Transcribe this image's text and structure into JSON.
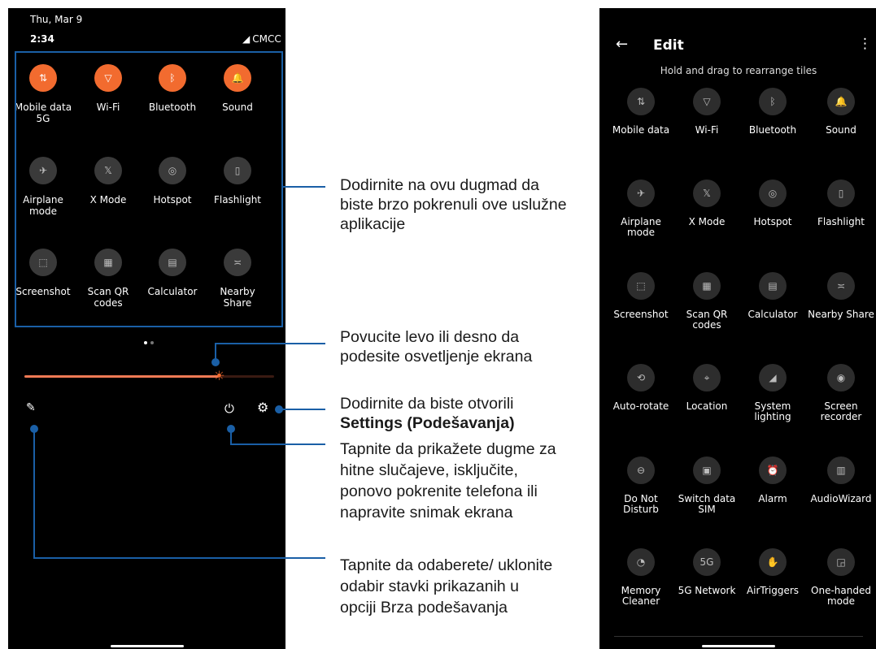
{
  "left_phone": {
    "date": "Thu, Mar 9",
    "time": "2:34",
    "carrier": "CMCC",
    "tiles": [
      {
        "icon": "mobile-data-icon",
        "glyph": "⇅",
        "label": "Mobile data\n5G",
        "active": true
      },
      {
        "icon": "wifi-icon",
        "glyph": "▽",
        "label": "Wi-Fi",
        "active": true
      },
      {
        "icon": "bluetooth-icon",
        "glyph": "ᛒ",
        "label": "Bluetooth",
        "active": true
      },
      {
        "icon": "bell-icon",
        "glyph": "🔔",
        "label": "Sound",
        "active": true
      },
      {
        "icon": "airplane-icon",
        "glyph": "✈",
        "label": "Airplane\nmode",
        "active": false
      },
      {
        "icon": "x-mode-icon",
        "glyph": "𝕏",
        "label": "X Mode",
        "active": false
      },
      {
        "icon": "hotspot-icon",
        "glyph": "◎",
        "label": "Hotspot",
        "active": false
      },
      {
        "icon": "flashlight-icon",
        "glyph": "▯",
        "label": "Flashlight",
        "active": false
      },
      {
        "icon": "screenshot-icon",
        "glyph": "⬚",
        "label": "Screenshot",
        "active": false
      },
      {
        "icon": "qr-code-icon",
        "glyph": "▦",
        "label": "Scan QR\ncodes",
        "active": false
      },
      {
        "icon": "calculator-icon",
        "glyph": "▤",
        "label": "Calculator",
        "active": false
      },
      {
        "icon": "nearby-share-icon",
        "glyph": "≍",
        "label": "Nearby Share",
        "active": false
      }
    ],
    "brightness_level": 0.78,
    "colors": {
      "accent": "#f26b2f",
      "callout": "#1a5fa6"
    }
  },
  "callouts": {
    "tiles": "Dodirnite na ovu dugmad da biste brzo pokrenuli ove uslužne aplikacije",
    "brightness": "Povucite levo ili desno da podesite osvetljenje ekrana",
    "settings_pre": "Dodirnite da biste otvorili",
    "settings_bold": "Settings (Podešavanja)",
    "power": "Tapnite da prikažete dugme za hitne slučajeve, isključite, ponovo pokrenite telefona ili napravite snimak ekrana",
    "edit": "Tapnite da odaberete/ uklonite odabir stavki prikazanih u opciji Brza podešavanja"
  },
  "right_phone": {
    "title": "Edit",
    "hint": "Hold and drag to rearrange tiles",
    "tiles": [
      {
        "icon": "mobile-data-icon",
        "glyph": "⇅",
        "label": "Mobile data"
      },
      {
        "icon": "wifi-icon",
        "glyph": "▽",
        "label": "Wi-Fi"
      },
      {
        "icon": "bluetooth-icon",
        "glyph": "ᛒ",
        "label": "Bluetooth"
      },
      {
        "icon": "bell-icon",
        "glyph": "🔔",
        "label": "Sound"
      },
      {
        "icon": "airplane-icon",
        "glyph": "✈",
        "label": "Airplane\nmode"
      },
      {
        "icon": "x-mode-icon",
        "glyph": "𝕏",
        "label": "X Mode"
      },
      {
        "icon": "hotspot-icon",
        "glyph": "◎",
        "label": "Hotspot"
      },
      {
        "icon": "flashlight-icon",
        "glyph": "▯",
        "label": "Flashlight"
      },
      {
        "icon": "screenshot-icon",
        "glyph": "⬚",
        "label": "Screenshot"
      },
      {
        "icon": "qr-code-icon",
        "glyph": "▦",
        "label": "Scan QR\ncodes"
      },
      {
        "icon": "calculator-icon",
        "glyph": "▤",
        "label": "Calculator"
      },
      {
        "icon": "nearby-share-icon",
        "glyph": "≍",
        "label": "Nearby Share"
      },
      {
        "icon": "auto-rotate-icon",
        "glyph": "⟲",
        "label": "Auto-rotate"
      },
      {
        "icon": "location-icon",
        "glyph": "⌖",
        "label": "Location"
      },
      {
        "icon": "system-lighting-icon",
        "glyph": "◢",
        "label": "System\nlighting"
      },
      {
        "icon": "screen-recorder-icon",
        "glyph": "◉",
        "label": "Screen\nrecorder"
      },
      {
        "icon": "do-not-disturb-icon",
        "glyph": "⊖",
        "label": "Do Not\nDisturb"
      },
      {
        "icon": "sim-icon",
        "glyph": "▣",
        "label": "Switch data\nSIM"
      },
      {
        "icon": "alarm-icon",
        "glyph": "⏰",
        "label": "Alarm"
      },
      {
        "icon": "audiowizard-icon",
        "glyph": "▥",
        "label": "AudioWizard"
      },
      {
        "icon": "memory-cleaner-icon",
        "glyph": "◔",
        "label": "Memory\nCleaner"
      },
      {
        "icon": "5g-network-icon",
        "glyph": "5G",
        "label": "5G Network"
      },
      {
        "icon": "airtriggers-icon",
        "glyph": "✋",
        "label": "AirTriggers"
      },
      {
        "icon": "one-handed-icon",
        "glyph": "◲",
        "label": "One-handed\nmode"
      }
    ]
  }
}
